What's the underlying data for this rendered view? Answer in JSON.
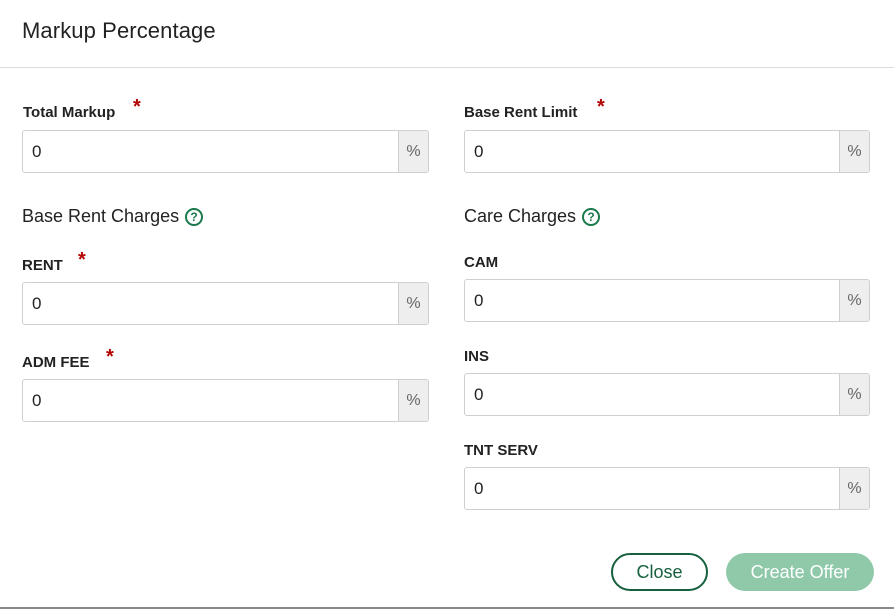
{
  "dialog": {
    "title": "Markup Percentage",
    "required_marker": "*",
    "unit_symbol": "%",
    "help_glyph": "?"
  },
  "total_markup": {
    "label": "Total Markup",
    "value": "0",
    "required": true
  },
  "base_rent_limit": {
    "label": "Base Rent Limit",
    "value": "0",
    "required": true
  },
  "base_rent_charges": {
    "title": "Base Rent Charges",
    "help_icon": "question-circle-icon",
    "fields": [
      {
        "label": "RENT",
        "value": "0",
        "required": true
      },
      {
        "label": "ADM FEE",
        "value": "0",
        "required": true
      }
    ]
  },
  "care_charges": {
    "title": "Care Charges",
    "help_icon": "question-circle-icon",
    "fields": [
      {
        "label": "CAM",
        "value": "0",
        "required": false
      },
      {
        "label": "INS",
        "value": "0",
        "required": false
      },
      {
        "label": "TNT SERV",
        "value": "0",
        "required": false
      }
    ]
  },
  "actions": {
    "close_label": "Close",
    "create_label": "Create Offer",
    "create_disabled": true
  },
  "colors": {
    "accent": "#17603d",
    "required": "#b30000",
    "disabled_button": "#8fc9aa"
  }
}
